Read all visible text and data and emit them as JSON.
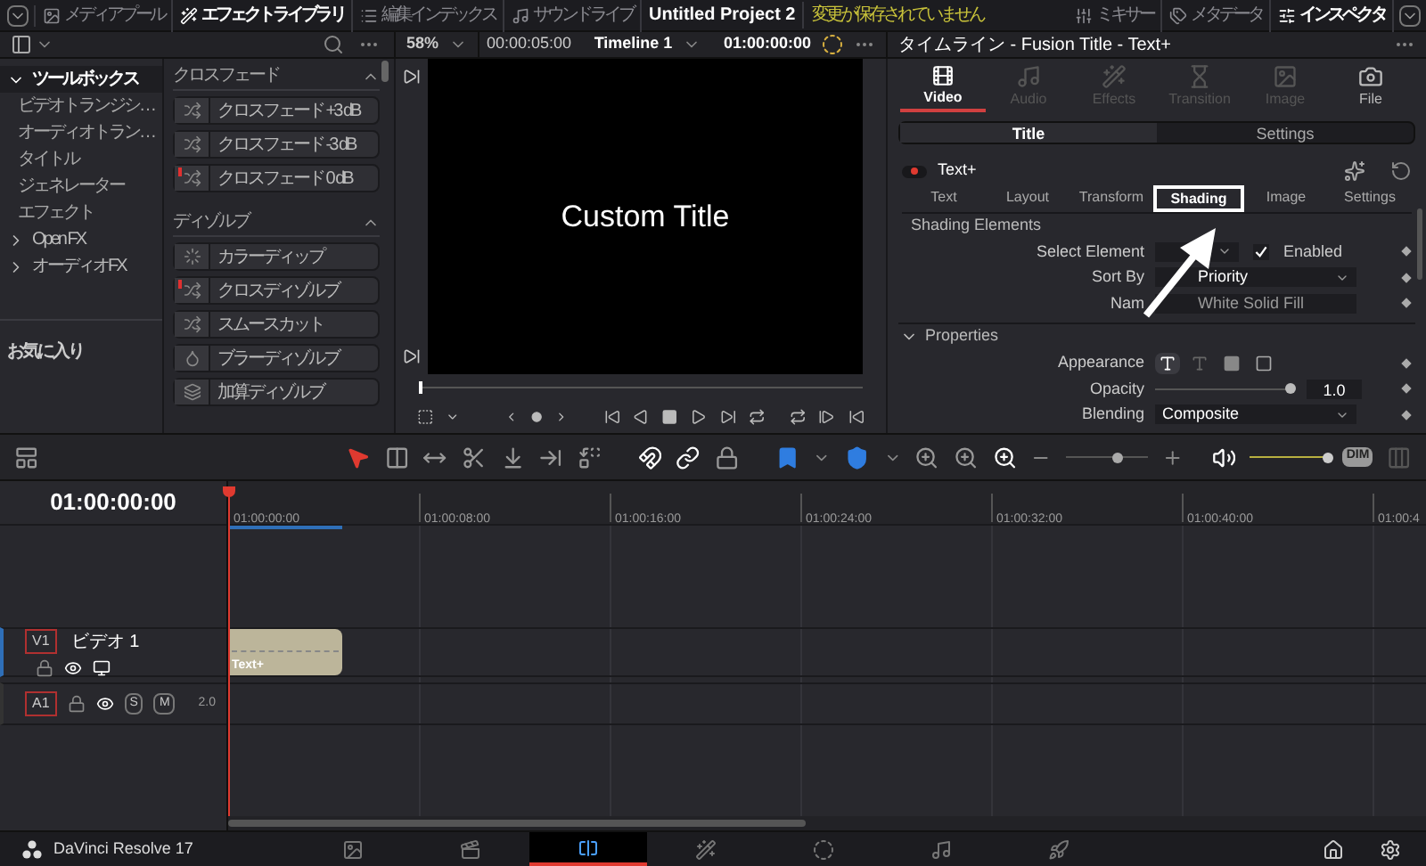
{
  "top_bar": {
    "left_items": [
      {
        "label": "メディアプール",
        "kind": "media",
        "selected": false
      },
      {
        "label": "エフェクトライブラリ",
        "kind": "effects",
        "selected": true
      },
      {
        "label": "編集インデックス",
        "kind": "index",
        "selected": false
      },
      {
        "label": "サウンドライブ",
        "kind": "sound",
        "selected": false
      }
    ],
    "title": "Untitled Project 2",
    "unsaved_notice": "変更が保存されていません",
    "right_items": [
      {
        "label": "ミキサー",
        "kind": "mixer",
        "selected": false
      },
      {
        "label": "メタデータ",
        "kind": "metadata",
        "selected": false
      },
      {
        "label": "インスペクタ",
        "kind": "inspector",
        "selected": true
      }
    ]
  },
  "viewer_bar": {
    "zoom": "58%",
    "duration": "00:00:05:00",
    "timeline_name": "Timeline 1",
    "timecode": "01:00:00:00"
  },
  "sidebar": {
    "tree": [
      {
        "label": "ツールボックス",
        "expanded": true,
        "selected": true,
        "children": [
          {
            "label": "ビデオトランジシ…",
            "selected": false
          },
          {
            "label": "オーディオトラン…",
            "selected": false
          },
          {
            "label": "タイトル",
            "selected": false
          },
          {
            "label": "ジェネレーター",
            "selected": false
          },
          {
            "label": "エフェクト",
            "selected": false
          }
        ]
      },
      {
        "label": "Open FX",
        "expanded": false,
        "selected": false
      },
      {
        "label": "オーディオFX",
        "expanded": false,
        "selected": false
      }
    ],
    "favorites": "お気に入り"
  },
  "effects": {
    "groups": [
      {
        "title": "クロスフェード",
        "expanded": true,
        "items": [
          {
            "label": "クロスフェード +3 dB",
            "kind": "audio",
            "flagged": false
          },
          {
            "label": "クロスフェード -3 dB",
            "kind": "audio",
            "flagged": false
          },
          {
            "label": "クロスフェード 0 dB",
            "kind": "audio",
            "flagged": true
          }
        ]
      },
      {
        "title": "ディゾルブ",
        "expanded": true,
        "items": [
          {
            "label": "カラーディップ",
            "kind": "dip",
            "flagged": false
          },
          {
            "label": "クロスディゾルブ",
            "kind": "cross",
            "flagged": true
          },
          {
            "label": "スムースカット",
            "kind": "cross",
            "flagged": false
          },
          {
            "label": "ブラーディゾルブ",
            "kind": "blur",
            "flagged": false
          },
          {
            "label": "加算ディゾルブ",
            "kind": "additive",
            "flagged": false
          }
        ]
      }
    ]
  },
  "viewer": {
    "caption": "Custom Title",
    "scrubber": {
      "level": 0
    }
  },
  "inspector": {
    "title": "タイムライン - Fusion Title - Text+",
    "tabs": [
      {
        "label": "Video",
        "kind": "video",
        "selected": true,
        "disabled": false
      },
      {
        "label": "Audio",
        "kind": "audio",
        "selected": false,
        "disabled": true
      },
      {
        "label": "Effects",
        "kind": "effects",
        "selected": false,
        "disabled": true
      },
      {
        "label": "Transition",
        "kind": "transition",
        "selected": false,
        "disabled": true
      },
      {
        "label": "Image",
        "kind": "image",
        "selected": false,
        "disabled": true
      },
      {
        "label": "File",
        "kind": "file",
        "selected": false,
        "disabled": false
      }
    ],
    "modes": [
      {
        "label": "Title",
        "selected": true
      },
      {
        "label": "Settings",
        "selected": false
      }
    ],
    "node": {
      "label": "Text+",
      "on": true
    },
    "sub_tabs": [
      {
        "label": "Text",
        "selected": false
      },
      {
        "label": "Layout",
        "selected": false
      },
      {
        "label": "Transform",
        "selected": false
      },
      {
        "label": "Shading",
        "selected": true
      },
      {
        "label": "Image",
        "selected": false
      },
      {
        "label": "Settings",
        "selected": false
      }
    ],
    "shading_elements": {
      "heading": "Shading Elements",
      "select_element": {
        "label": "Select Element"
      },
      "enabled": {
        "label": "Enabled",
        "checked": true
      },
      "sort_by": {
        "label": "Sort By",
        "value": "Priority"
      },
      "name": {
        "label": "Nam",
        "value": "White Solid Fill"
      }
    },
    "properties": {
      "heading": "Properties",
      "expanded": true,
      "appearance": {
        "label": "Appearance",
        "options": [
          {
            "kind": "text-solid",
            "selected": true
          },
          {
            "kind": "text-outline",
            "selected": false
          },
          {
            "kind": "filled",
            "selected": false
          },
          {
            "kind": "outline",
            "selected": false
          }
        ]
      },
      "opacity": {
        "label": "Opacity",
        "level": 0.97,
        "reading": "1.0"
      },
      "blending": {
        "label": "Blending",
        "value": "Composite"
      }
    }
  },
  "timeline": {
    "timecode": "01:00:00:00",
    "ruler": [
      "01:00:00:00",
      "01:00:08:00",
      "01:00:16:00",
      "01:00:24:00",
      "01:00:32:00",
      "01:00:40:00",
      "01:00:4"
    ],
    "zoom_slider": {
      "level": 0.62
    },
    "volume": {
      "level": 1
    },
    "dim": "DIM",
    "tracks": [
      {
        "kind": "video",
        "badge": "V1",
        "name": "ビデオ 1",
        "clip": "Text+"
      },
      {
        "kind": "audio",
        "badge": "A1",
        "buttons": [
          "S",
          "M"
        ],
        "channels": "2.0"
      }
    ]
  },
  "bottom_bar": {
    "app_name": "DaVinci Resolve 17",
    "pages": [
      {
        "kind": "media",
        "selected": false
      },
      {
        "kind": "cut",
        "selected": false
      },
      {
        "kind": "edit",
        "selected": true
      },
      {
        "kind": "fusion",
        "selected": false
      },
      {
        "kind": "color",
        "selected": false
      },
      {
        "kind": "fairlight",
        "selected": false
      },
      {
        "kind": "deliver",
        "selected": false
      }
    ]
  }
}
